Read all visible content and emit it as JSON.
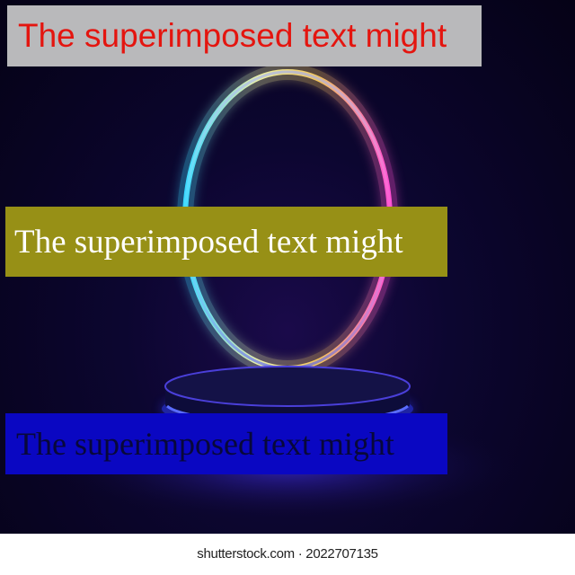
{
  "image": {
    "subject": "neon-ring-podium",
    "colors": {
      "background": "#07031e",
      "ring_cyan": "#39d8ff",
      "ring_yellow": "#f4e35a",
      "ring_pink": "#ff4fd2",
      "podium_glow": "#3a4cff"
    }
  },
  "overlays": [
    {
      "text": "The superimposed text might",
      "text_color": "#e4150f",
      "background": "#b9b9bb"
    },
    {
      "text": "The superimposed text might",
      "text_color": "#ffffff",
      "background": "#979016"
    },
    {
      "text": "The superimposed text might",
      "text_color": "#08083a",
      "background": "#0a07c2"
    }
  ],
  "watermark": {
    "text": "shutterstock.com · 2022707135"
  }
}
